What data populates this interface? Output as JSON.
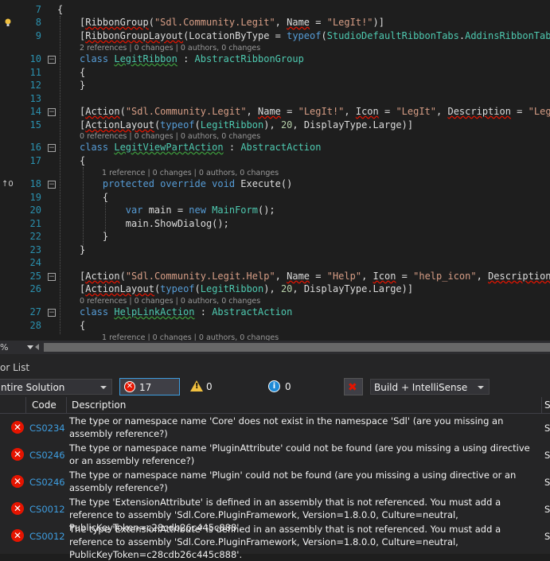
{
  "editor": {
    "lines": [
      {
        "n": 7,
        "parts": [
          [
            "{",
            ""
          ]
        ]
      },
      {
        "n": 8,
        "parts": [
          [
            "[",
            ""
          ],
          [
            "RibbonGroup",
            "sq"
          ],
          [
            "(",
            ""
          ],
          [
            "\"Sdl.Community.Legit\"",
            "st"
          ],
          [
            ", ",
            ""
          ],
          [
            "Name",
            "sq"
          ],
          [
            " = ",
            ""
          ],
          [
            "\"LegIt!\"",
            "st"
          ],
          [
            ")]",
            ""
          ]
        ]
      },
      {
        "n": 9,
        "parts": [
          [
            "[",
            ""
          ],
          [
            "RibbonGroupLayout",
            "sq"
          ],
          [
            "(LocationByType = ",
            ""
          ],
          [
            "typeof",
            "kw"
          ],
          [
            "(",
            ""
          ],
          [
            "StudioDefaultRibbonTabs",
            "ty"
          ],
          [
            ".",
            ""
          ],
          [
            "AddinsRibbonTabLocat",
            "ty"
          ]
        ]
      },
      {
        "n": 10,
        "parts": [
          [
            "class ",
            "kw"
          ],
          [
            "LegitRibbon",
            "ty grn"
          ],
          [
            " : ",
            ""
          ],
          [
            "AbstractRibbonGroup",
            "ty"
          ]
        ]
      },
      {
        "n": 11,
        "parts": [
          [
            "{",
            ""
          ]
        ]
      },
      {
        "n": 12,
        "parts": [
          [
            "}",
            ""
          ]
        ]
      },
      {
        "n": 13,
        "parts": [
          [
            "",
            ""
          ]
        ]
      },
      {
        "n": 14,
        "parts": [
          [
            "[",
            ""
          ],
          [
            "Action",
            "sq"
          ],
          [
            "(",
            ""
          ],
          [
            "\"Sdl.Community.Legit\"",
            "st"
          ],
          [
            ", ",
            ""
          ],
          [
            "Name",
            "sq"
          ],
          [
            " = ",
            ""
          ],
          [
            "\"LegIt!\"",
            "st"
          ],
          [
            ", ",
            ""
          ],
          [
            "Icon",
            "sq"
          ],
          [
            " = ",
            ""
          ],
          [
            "\"LegIt\"",
            "st"
          ],
          [
            ", ",
            ""
          ],
          [
            "Description",
            "sq"
          ],
          [
            " = ",
            ""
          ],
          [
            "\"LegIt!\"",
            "st"
          ]
        ]
      },
      {
        "n": 15,
        "parts": [
          [
            "[",
            ""
          ],
          [
            "ActionLayout",
            "sq"
          ],
          [
            "(",
            ""
          ],
          [
            "typeof",
            "kw"
          ],
          [
            "(",
            ""
          ],
          [
            "LegitRibbon",
            "ty"
          ],
          [
            "), ",
            ""
          ],
          [
            "20",
            "nm"
          ],
          [
            ", DisplayType.Large)]",
            ""
          ]
        ]
      },
      {
        "n": 16,
        "parts": [
          [
            "class ",
            "kw"
          ],
          [
            "LegitViewPartAction",
            "ty grn"
          ],
          [
            " : ",
            ""
          ],
          [
            "AbstractAction",
            "ty"
          ]
        ]
      },
      {
        "n": 17,
        "parts": [
          [
            "{",
            ""
          ]
        ]
      },
      {
        "n": 18,
        "parts": [
          [
            "    protected override void ",
            "kw"
          ],
          [
            "Execute()",
            ""
          ]
        ]
      },
      {
        "n": 19,
        "parts": [
          [
            "    {",
            ""
          ]
        ]
      },
      {
        "n": 20,
        "parts": [
          [
            "        var ",
            "kw"
          ],
          [
            "main = ",
            ""
          ],
          [
            "new ",
            "kw"
          ],
          [
            "MainForm",
            "ty"
          ],
          [
            "();",
            ""
          ]
        ]
      },
      {
        "n": 21,
        "parts": [
          [
            "        main.ShowDialog();",
            ""
          ]
        ]
      },
      {
        "n": 22,
        "parts": [
          [
            "    }",
            ""
          ]
        ]
      },
      {
        "n": 23,
        "parts": [
          [
            "}",
            ""
          ]
        ]
      },
      {
        "n": 24,
        "parts": [
          [
            "",
            ""
          ]
        ]
      },
      {
        "n": 25,
        "parts": [
          [
            "[",
            ""
          ],
          [
            "Action",
            "sq"
          ],
          [
            "(",
            ""
          ],
          [
            "\"Sdl.Community.Legit.Help\"",
            "st"
          ],
          [
            ", ",
            ""
          ],
          [
            "Name",
            "sq"
          ],
          [
            " = ",
            ""
          ],
          [
            "\"Help\"",
            "st"
          ],
          [
            ", ",
            ""
          ],
          [
            "Icon",
            "sq"
          ],
          [
            " = ",
            ""
          ],
          [
            "\"help_icon\"",
            "st"
          ],
          [
            ", ",
            ""
          ],
          [
            "Description",
            "sq"
          ],
          [
            " = ",
            ""
          ],
          [
            "\"",
            "st"
          ]
        ]
      },
      {
        "n": 26,
        "parts": [
          [
            "[",
            ""
          ],
          [
            "ActionLayout",
            "sq"
          ],
          [
            "(",
            ""
          ],
          [
            "typeof",
            "kw"
          ],
          [
            "(",
            ""
          ],
          [
            "LegitRibbon",
            "ty"
          ],
          [
            "), ",
            ""
          ],
          [
            "20",
            "nm"
          ],
          [
            ", DisplayType.Large)]",
            ""
          ]
        ]
      },
      {
        "n": 27,
        "parts": [
          [
            "class ",
            "kw"
          ],
          [
            "HelpLinkAction",
            "ty grn"
          ],
          [
            " : ",
            ""
          ],
          [
            "AbstractAction",
            "ty"
          ]
        ]
      },
      {
        "n": 28,
        "parts": [
          [
            "{",
            ""
          ]
        ]
      }
    ],
    "lens": {
      "r2": "2 references | 0 changes | 0 authors, 0 changes",
      "r0": "0 references | 0 changes | 0 authors, 0 changes",
      "r1": "1 reference | 0 changes | 0 authors, 0 changes"
    },
    "margin_glyph": "↑0",
    "zoom": "%"
  },
  "error_list": {
    "title": "or List",
    "scope": "ntire Solution",
    "errors_btn": "17 Errors",
    "warnings_btn": "0 Warnings",
    "messages_btn": "0 Messages",
    "build_filter": "Build + IntelliSense",
    "col_code": "Code",
    "col_desc": "Description",
    "col_proj": "S",
    "rows": [
      {
        "code": "CS0234",
        "desc": "The type or namespace name 'Core' does not exist in the namespace 'Sdl' (are you missing an assembly reference?)",
        "proj": "S"
      },
      {
        "code": "CS0246",
        "desc": "The type or namespace name 'PluginAttribute' could not be found (are you missing a using directive or an assembly reference?)",
        "proj": "S"
      },
      {
        "code": "CS0246",
        "desc": "The type or namespace name 'Plugin' could not be found (are you missing a using directive or an assembly reference?)",
        "proj": "S"
      },
      {
        "code": "CS0012",
        "desc": "The type 'ExtensionAttribute' is defined in an assembly that is not referenced. You must add a reference to assembly 'Sdl.Core.PluginFramework, Version=1.8.0.0, Culture=neutral, PublicKeyToken=c28cdb26c445c888'.",
        "proj": "S"
      },
      {
        "code": "CS0012",
        "desc": "The type 'ExtensionAttribute' is defined in an assembly that is not referenced. You must add a reference to assembly 'Sdl.Core.PluginFramework, Version=1.8.0.0, Culture=neutral, PublicKeyToken=c28cdb26c445c888'.",
        "proj": "S"
      }
    ]
  },
  "colors": {
    "error": "#e51400",
    "link": "#3e9ddf",
    "line_number": "#2b91af",
    "bg": "#1e1e1e"
  }
}
